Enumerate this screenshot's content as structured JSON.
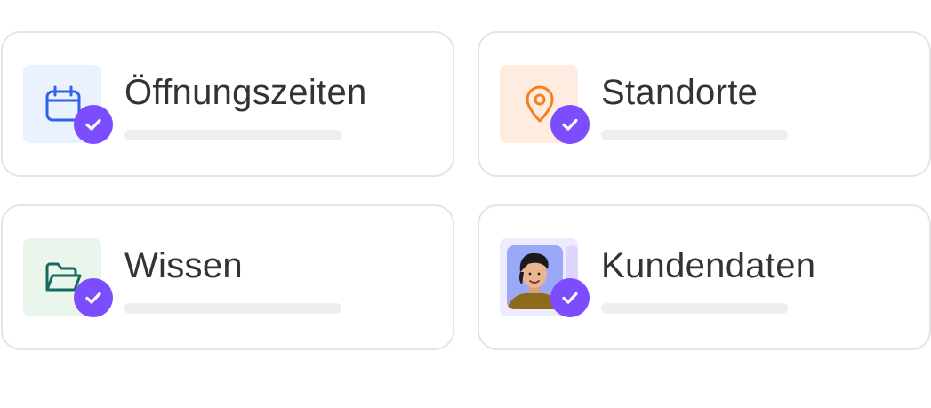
{
  "colors": {
    "check_badge": "#7c4dff",
    "card_border": "#e4e4e4",
    "placeholder_bar": "#eeeeee",
    "label_text": "#333333"
  },
  "cards": [
    {
      "label": "Öffnungszeiten",
      "icon": "calendar-icon",
      "tile_bg": "#eaf1ff",
      "icon_color": "#2e62e8",
      "checked": true
    },
    {
      "label": "Standorte",
      "icon": "map-pin-icon",
      "tile_bg": "#ffece0",
      "icon_color": "#f5801f",
      "checked": true
    },
    {
      "label": "Wissen",
      "icon": "folder-icon",
      "tile_bg": "#eaf5ec",
      "icon_color": "#176b5c",
      "checked": true
    },
    {
      "label": "Kundendaten",
      "icon": "customer-avatar",
      "tile_bg": "#efebff",
      "icon_color": "#9aa8f7",
      "checked": true
    }
  ]
}
